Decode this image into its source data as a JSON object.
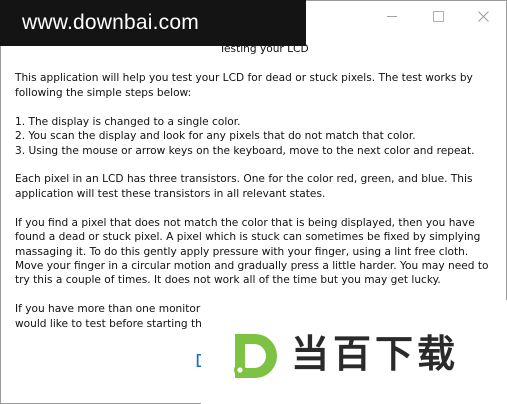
{
  "watermark": {
    "url": "www.downbai.com"
  },
  "window": {
    "controls": {
      "minimize_icon": "minimize-icon",
      "maximize_icon": "maximize-icon",
      "close_icon": "close-icon"
    }
  },
  "content": {
    "heading": "Testing your LCD",
    "intro": [
      "This application will help you test your LCD for dead or stuck pixels.  The test works by",
      "following the simple steps below:"
    ],
    "steps": [
      "1. The display is changed to a single color.",
      "2. You scan the display and look for any pixels that do not match that color.",
      "3. Using the mouse or arrow keys on the keyboard, move to the next color and repeat."
    ],
    "transistors": [
      "Each pixel in an LCD has three transistors.  One for the color red, green, and blue.  This",
      "application will test these transistors in all relevant states."
    ],
    "fix": [
      "If you find a pixel that does not match the color that is being displayed, then you have",
      "found a dead or stuck pixel.  A pixel which is stuck can sometimes be fixed by simplying",
      "massaging it.  To do this gently apply pressure with your finger, using a lint free cloth.",
      "Move your finger in a circular motion and gradually press a little harder.  You may need to",
      "try this a couple of times.  It does not work all of the time but you may get lucky."
    ],
    "monitor": [
      "If you have more than one monitor,",
      "would like to test before starting th"
    ],
    "bottom_partial": "D"
  },
  "logo": {
    "mark_letter": "D",
    "text": "当百下载",
    "colors": {
      "green": "#7dc242",
      "text": "#2a2a2a"
    }
  }
}
